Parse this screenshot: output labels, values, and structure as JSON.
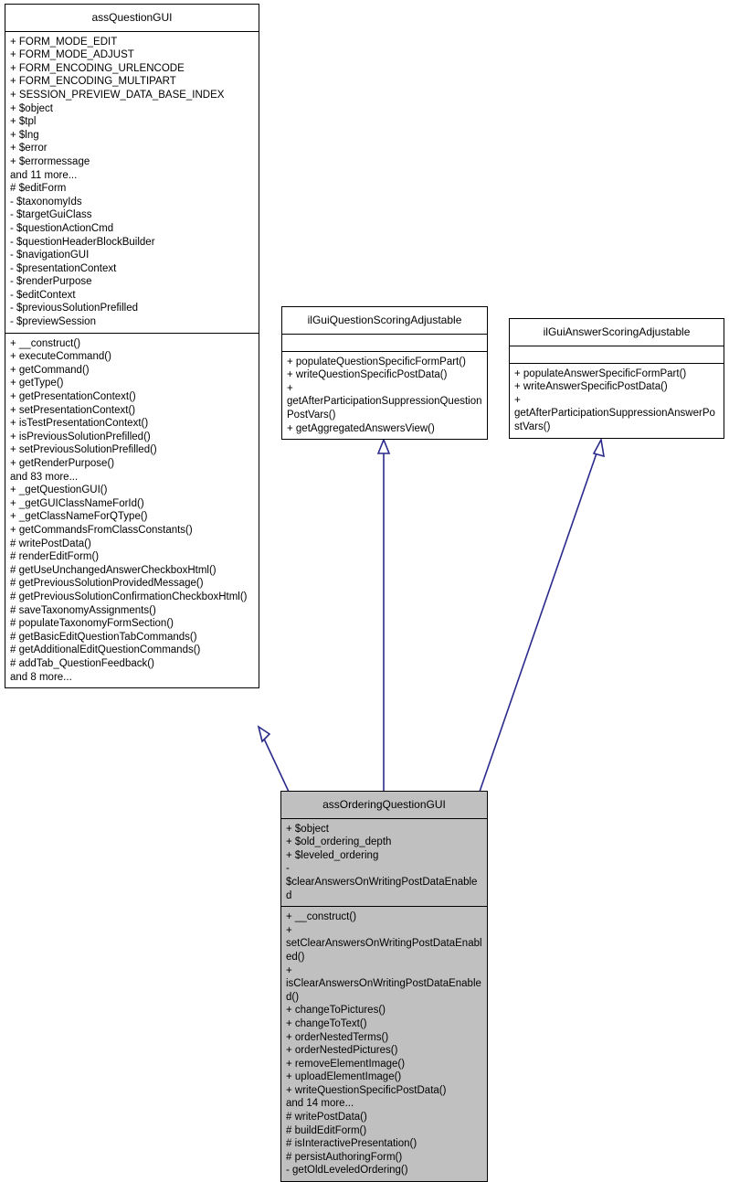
{
  "diagram": {
    "type": "uml-class-inheritance-diagram",
    "background": "#ffffff",
    "line_color": "#2a2a8c",
    "highlight_fill": "#c0c0c0",
    "border_color": "#000000"
  },
  "classes": {
    "assQuestionGUI": {
      "name": "assQuestionGUI",
      "highlighted": false,
      "attributes": [
        "+ FORM_MODE_EDIT",
        "+ FORM_MODE_ADJUST",
        "+ FORM_ENCODING_URLENCODE",
        "+ FORM_ENCODING_MULTIPART",
        "+ SESSION_PREVIEW_DATA_BASE_INDEX",
        "+ $object",
        "+ $tpl",
        "+ $lng",
        "+ $error",
        "+ $errormessage",
        "and 11 more...",
        "# $editForm",
        "- $taxonomyIds",
        "- $targetGuiClass",
        "- $questionActionCmd",
        "- $questionHeaderBlockBuilder",
        "- $navigationGUI",
        "- $presentationContext",
        "- $renderPurpose",
        "- $editContext",
        "- $previousSolutionPrefilled",
        "- $previewSession"
      ],
      "operations": [
        "+ __construct()",
        "+ executeCommand()",
        "+ getCommand()",
        "+ getType()",
        "+ getPresentationContext()",
        "+ setPresentationContext()",
        "+ isTestPresentationContext()",
        "+ isPreviousSolutionPrefilled()",
        "+ setPreviousSolutionPrefilled()",
        "+ getRenderPurpose()",
        "and 83 more...",
        "+ _getQuestionGUI()",
        "+ _getGUIClassNameForId()",
        "+ _getClassNameForQType()",
        "+ getCommandsFromClassConstants()",
        "# writePostData()",
        "# renderEditForm()",
        "# getUseUnchangedAnswerCheckboxHtml()",
        "# getPreviousSolutionProvidedMessage()",
        "# getPreviousSolutionConfirmationCheckboxHtml()",
        "# saveTaxonomyAssignments()",
        "# populateTaxonomyFormSection()",
        "# getBasicEditQuestionTabCommands()",
        "# getAdditionalEditQuestionCommands()",
        "# addTab_QuestionFeedback()",
        "and 8 more..."
      ]
    },
    "ilGuiQuestionScoringAdjustable": {
      "name": "ilGuiQuestionScoringAdjustable",
      "highlighted": false,
      "attributes": [],
      "operations": [
        "+ populateQuestionSpecificFormPart()",
        "+ writeQuestionSpecificPostData()",
        "+ getAfterParticipationSuppressionQuestionPostVars()",
        "+ getAggregatedAnswersView()"
      ]
    },
    "ilGuiAnswerScoringAdjustable": {
      "name": "ilGuiAnswerScoringAdjustable",
      "highlighted": false,
      "attributes": [],
      "operations": [
        "+ populateAnswerSpecificFormPart()",
        "+ writeAnswerSpecificPostData()",
        "+ getAfterParticipationSuppressionAnswerPostVars()"
      ]
    },
    "assOrderingQuestionGUI": {
      "name": "assOrderingQuestionGUI",
      "highlighted": true,
      "attributes": [
        "+ $object",
        "+ $old_ordering_depth",
        "+ $leveled_ordering",
        "- $clearAnswersOnWritingPostDataEnabled"
      ],
      "operations": [
        "+ __construct()",
        "+ setClearAnswersOnWritingPostDataEnabled()",
        "+ isClearAnswersOnWritingPostDataEnabled()",
        "+ changeToPictures()",
        "+ changeToText()",
        "+ orderNestedTerms()",
        "+ orderNestedPictures()",
        "+ removeElementImage()",
        "+ uploadElementImage()",
        "+ writeQuestionSpecificPostData()",
        "and 14 more...",
        "# writePostData()",
        "# buildEditForm()",
        "# isInteractivePresentation()",
        "# persistAuthoringForm()",
        "- getOldLeveledOrdering()"
      ]
    }
  },
  "relations": [
    {
      "name": "inheritance-assorderingquestiongui-to-assquestiongui",
      "from": "assOrderingQuestionGUI",
      "to": "assQuestionGUI",
      "kind": "generalization"
    },
    {
      "name": "inheritance-assorderingquestiongui-to-ilguiquestionscoringadjustable",
      "from": "assOrderingQuestionGUI",
      "to": "ilGuiQuestionScoringAdjustable",
      "kind": "generalization"
    },
    {
      "name": "inheritance-assorderingquestiongui-to-ilguianswerscoringadjustable",
      "from": "assOrderingQuestionGUI",
      "to": "ilGuiAnswerScoringAdjustable",
      "kind": "generalization"
    }
  ]
}
